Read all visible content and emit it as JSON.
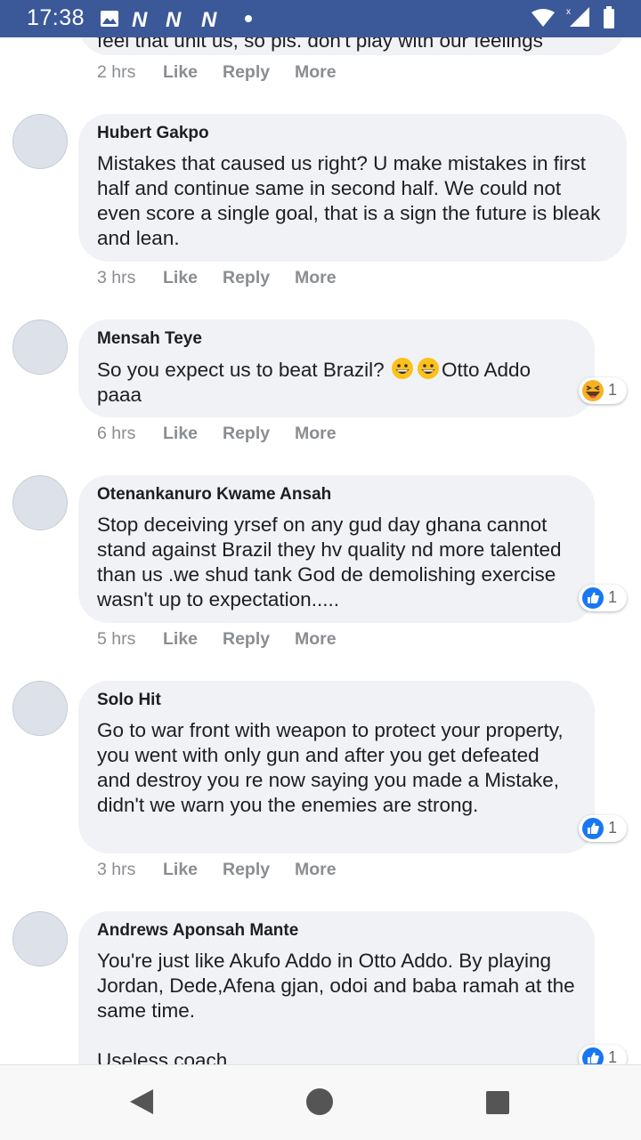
{
  "status_bar": {
    "time": "17:38"
  },
  "top_comment": {
    "partial_text": "feel that unit us, so pls. don't play with our feelings",
    "time": "2 hrs"
  },
  "action_labels": {
    "like": "Like",
    "reply": "Reply",
    "more": "More"
  },
  "comments": [
    {
      "author": "Hubert Gakpo",
      "text": "Mistakes that caused us right? U make mistakes in first half and continue same in second half. We could not even score a single goal, that is a sign the future is bleak and lean.",
      "time": "3 hrs"
    },
    {
      "author": "Mensah Teye",
      "text_before": "So you expect us to beat Brazil? ",
      "text_after": "Otto Addo paaa",
      "time": "6 hrs",
      "reaction": {
        "icon": "haha-reaction-icon",
        "count": "1"
      }
    },
    {
      "author": "Otenankanuro Kwame Ansah",
      "text": "Stop deceiving yrsef on any gud day ghana cannot stand against Brazil they hv quality nd more talented than us .we shud tank God de demolishing exercise wasn't up to expectation.....",
      "time": "5 hrs",
      "reaction": {
        "icon": "like-reaction-icon",
        "count": "1"
      }
    },
    {
      "author": "Solo Hit",
      "text": "Go to war front with weapon to protect your property, you went with only gun and after you get defeated and destroy you re now saying you made a Mistake, didn't we warn you the enemies are strong.",
      "time": "3 hrs",
      "reaction": {
        "icon": "like-reaction-icon",
        "count": "1"
      }
    },
    {
      "author": "Andrews Aponsah Mante",
      "text": "You're just like Akufo Addo in Otto Addo. By playing Jordan, Dede,Afena gjan, odoi and baba ramah at the same time.\n\nUseless coach",
      "reaction": {
        "icon": "like-reaction-icon",
        "count": "1"
      }
    }
  ],
  "colors": {
    "brand": "#3b5998",
    "bubble": "#f0f2f5",
    "like_blue": "#1877f2",
    "muted": "#8a8d91"
  }
}
